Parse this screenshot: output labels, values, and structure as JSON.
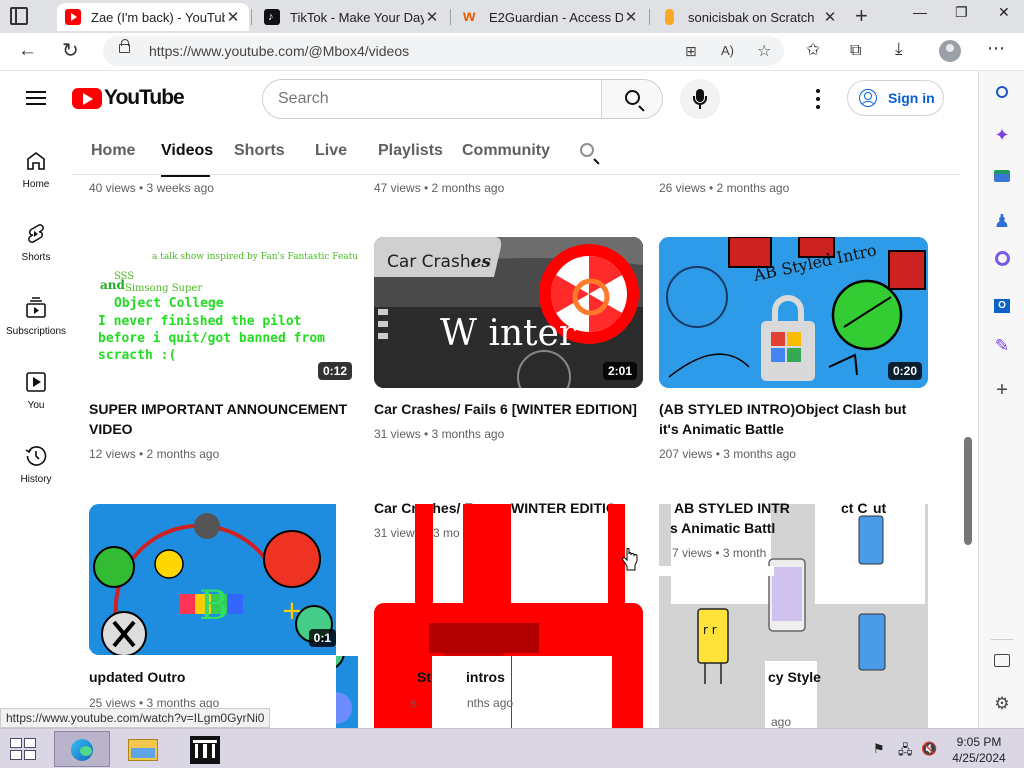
{
  "browser": {
    "tabs": [
      {
        "title": "Zae (I'm back) - YouTub",
        "favicon": "youtube-icon",
        "active": true
      },
      {
        "title": "TikTok - Make Your Day",
        "favicon": "tiktok-icon",
        "active": false
      },
      {
        "title": "E2Guardian - Access De",
        "favicon": "e2guardian-icon",
        "active": false
      },
      {
        "title": "sonicisbak on Scratch",
        "favicon": "scratch-icon",
        "active": false
      }
    ],
    "new_tab": "+",
    "window_controls": {
      "minimize": "—",
      "restore": "❐",
      "close": "✕"
    },
    "url": "https://www.youtube.com/@Mbox4/videos",
    "toolbar_icons": [
      "apps-icon",
      "read-aloud-icon",
      "favorite-icon",
      "favorites-icon",
      "collections-icon",
      "downloads-icon",
      "profile-icon",
      "more-icon"
    ],
    "status_url": "https://www.youtube.com/watch?v=ILgm0GyrNi0"
  },
  "edge_sidebar": {
    "icons": [
      "search-icon",
      "copilot-icon",
      "shopping-icon",
      "games-icon",
      "m365-icon",
      "outlook-icon",
      "designer-icon",
      "add-icon",
      "split-screen-icon",
      "settings-icon"
    ]
  },
  "youtube": {
    "wordmark": "YouTube",
    "search": {
      "placeholder": "Search"
    },
    "sign_in": "Sign in",
    "guide": [
      {
        "label": "Home",
        "icon": "home-icon"
      },
      {
        "label": "Shorts",
        "icon": "shorts-icon"
      },
      {
        "label": "Subscriptions",
        "icon": "subscriptions-icon"
      },
      {
        "label": "You",
        "icon": "you-icon"
      },
      {
        "label": "History",
        "icon": "history-icon"
      }
    ],
    "channel_tabs": [
      "Home",
      "Videos",
      "Shorts",
      "Live",
      "Playlists",
      "Community"
    ],
    "active_tab": "Videos",
    "top_row_meta": [
      "40 views • 3 weeks ago",
      "47 views • 2 months ago",
      "26 views • 2 months ago"
    ],
    "videos": [
      {
        "title": "SUPER IMPORTANT ANNOUNCEMENT VIDEO",
        "meta": "12 views • 2 months ago",
        "duration": "0:12",
        "thumb_text": {
          "subtitle": "a talk show inspired by Fan's Fantastic Features",
          "sss": "SSS",
          "and": "and",
          "simsong": "Simsong Super",
          "college": "Object College",
          "body": "I never finished the pilot before i quit/got banned from scracth :("
        }
      },
      {
        "title": "Car Crashes/ Fails 6 [WINTER EDITION]",
        "meta": "31 views • 3 months ago",
        "duration": "2:01",
        "thumb_text": {
          "label": "Car Crash",
          "label_tail": "es",
          "winter": "W inter"
        }
      },
      {
        "title": "(AB STYLED INTRO)Object Clash but it's Animatic Battle",
        "meta": "207 views • 3 months ago",
        "duration": "0:20",
        "thumb_text": {
          "scribble": "AB Styled Intro"
        }
      },
      {
        "title": "updated Outro",
        "meta": "25 views • 3 months ago",
        "duration": "0:1"
      }
    ],
    "ghost_row": {
      "title_2": "Car Crashes/ F",
      "title_2b": "WINTER EDITIO",
      "meta_2a": "31 views",
      "meta_2b": "3 mo",
      "title_3a": "AB STYLED INTR",
      "title_3b": "ct C",
      "title_3c": "ut",
      "title_3d": "s Animatic Battl",
      "meta_3a": "7 views • 3 month",
      "row5_2a": "St",
      "row5_2b": "intros",
      "row5_2c": "s",
      "row5_2d": "nths ago",
      "row5_3a": "cy Style",
      "row5_3b": "ago"
    }
  },
  "taskbar": {
    "apps": [
      "start-icon",
      "edge-icon",
      "file-explorer-icon",
      "library-icon"
    ],
    "tray": [
      "flag-icon",
      "network-icon",
      "volume-muted-icon"
    ],
    "time": "9:05 PM",
    "date": "4/25/2024"
  },
  "colors": {
    "yt_red": "#ff0000",
    "link_blue": "#065fd4",
    "glitch_red": "#ff0000",
    "thumb_green": "#22dd22"
  }
}
